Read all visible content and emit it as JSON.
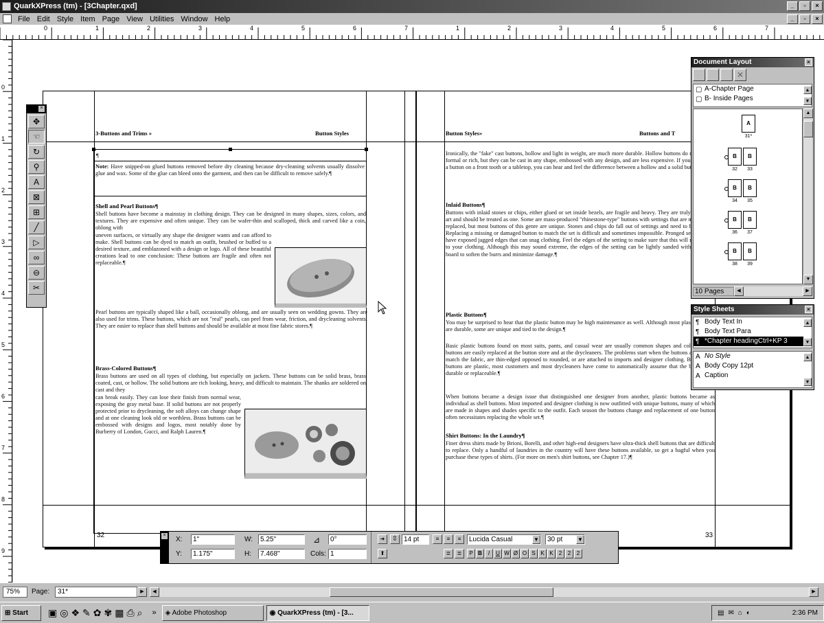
{
  "window": {
    "title": "QuarkXPress (tm) - [3Chapter.qxd]",
    "minimize": "_",
    "restore": "▫",
    "close": "×"
  },
  "menu": [
    "File",
    "Edit",
    "Style",
    "Item",
    "Page",
    "View",
    "Utilities",
    "Window",
    "Help"
  ],
  "ruler": {
    "top_labels": [
      "0",
      "1",
      "2",
      "3",
      "4",
      "5",
      "6",
      "7",
      "1",
      "2",
      "3",
      "4",
      "5",
      "6",
      "7"
    ],
    "side_labels": [
      "0",
      "1",
      "2",
      "3",
      "4",
      "5",
      "6",
      "7",
      "8",
      "9"
    ]
  },
  "left_page": {
    "running_left": "3-Buttons and Trims »",
    "running_right": "Button Styles",
    "pilcrow": "¶",
    "note_label": "Note:",
    "note_text": "Have snipped-on glued buttons removed before dry cleaning because dry-cleaning solvents usually dissolve glue and wax. Some of the glue can bleed onto the garment, and then can be difficult to remove safely.¶",
    "h1": "Shell and Pearl Buttons¶",
    "p1a": "Shell buttons have become a mainstay in clothing design. They can be designed in many shapes, sizes, colors, and textures. They are expensive and often unique. They can be wafer-thin and scalloped, thick and carved like a coin, oblong with",
    "p1b": "uneven surfaces, or virtually any shape the designer wants and can afford to make. Shell buttons can be dyed to match an outfit, brushed or buffed to a desired texture, and emblazoned with a design or logo. All of these beautiful creations lead to one conclusion: These buttons are fragile and often not replaceable.¶",
    "p2": "Pearl buttons are typically shaped like a ball, occasionally oblong, and are usually seen on wedding gowns. They are also used for trims. These buttons, which are not \"real\" pearls, can peel from wear, friction, and drycleaning solvents. They are easier to replace than shell buttons and should be available at most fine fabric stores.¶",
    "h2": "Brass-Colored Buttons¶",
    "p3a": "Brass buttons are used on all types of clothing, but especially on jackets. These buttons can be solid brass, brass coated, cast, or hollow. The solid buttons are rich looking, heavy, and difficult to maintain. The shanks are soldered on cast and they",
    "p3b": "can break easily. They can lose their finish from normal wear, exposing the gray metal base. If solid buttons are not properly protected prior to drycleaning, the soft alloys can change shape and at one cleaning look old or worthless. Brass buttons can be embossed with designs and logos, most notably done by Burberry of London, Gucci, and Ralph Lauren.¶",
    "folio": "32"
  },
  "right_page": {
    "running_left": "Button Styles»",
    "running_right": "Buttons and T",
    "p0": "Ironically, the \"fake\" cast buttons, hollow and light in weight, are much more durable. Hollow buttons do not look as formal or rich, but they can be cast in any shape, embossed with any design, and are less expensive. If you gently tap a button on a front tooth or a tabletop, you can hear and feel the difference between a hollow and a solid button.¶",
    "h1": "Inlaid Buttons¶",
    "p1": "Buttons with inlaid stones or chips, either glued or set inside bezels, are fragile and heavy. They are truly a work of art and should be treated as one. Some are mass-produced \"rhinestone-type\" buttons with settings that are more easily replaced, but most buttons of this genre are unique. Stones and chips do fall out of settings and need to be reglued. Replacing a missing or damaged button to match the set is difficult and sometimes impossible. Pronged settings may have exposed jagged edges that can snag clothing. Feel the edges of the setting to make sure that this will not happen to your clothing. Although this may sound extreme, the edges of the setting can be lightly sanded with an emery board to soften the burrs and minimize damage.¶",
    "h2": "Plastic Buttons¶",
    "p2": "You may be surprised to hear that the plastic button may be high maintenance as well. Although most plastic buttons are durable, some are unique and tied to the design.¶",
    "p3": "Basic plastic buttons found on most suits, pants, and casual wear are usually common shapes and colors. Black buttons are easily replaced at the button store and at the drycleaners. The problems start when the buttons are dyed to match the fabric, are thin-edged opposed to rounded, or are attached to imports and designer clothing. Because the buttons are plastic, most customers and most drycleaners have come to automatically assume that the buttons are durable or replaceable.¶",
    "p4": "When buttons became a design issue that distinguished one designer from another, plastic buttons became as individual as shell buttons. Most imported and designer clothing is now outfitted with unique buttons, many of which are made in shapes and shades specific to the outfit. Each season the buttons change and replacement of one button often necessitates replacing the whole set.¶",
    "h3": "Shirt Buttons: In the Laundry¶",
    "p5": "Finer dress shirts made by Brioni, Borelli, and other high-end designers have ultra-thick shell buttons that are difficult to replace. Only a handful of laundries in the country will have these buttons available, so get a bagful when you purchase these types of shirts. (For more on men's shirt buttons, see Chapter 17.)¶",
    "folio": "33"
  },
  "doc_layout": {
    "title": "Document Layout",
    "masters": [
      "A-Chapter Page",
      "B- Inside Pages"
    ],
    "first_page_label": "31*",
    "first_master": "A",
    "spreads": [
      {
        "left": "32",
        "right": "33",
        "master": "B"
      },
      {
        "left": "34",
        "right": "35",
        "master": "B"
      },
      {
        "left": "36",
        "right": "37",
        "master": "B"
      },
      {
        "left": "38",
        "right": "39",
        "master": "B"
      }
    ],
    "page_count": "10 Pages"
  },
  "style_sheets": {
    "title": "Style Sheets",
    "paragraph_styles": [
      "Body Text In",
      "Body Text Para",
      "*Chapter headingCtrl+KP 3"
    ],
    "selected_index": 2,
    "character_styles": [
      "No Style",
      "Body Copy 12pt",
      "Caption"
    ]
  },
  "measurements": {
    "x_label": "X:",
    "x_value": "1\"",
    "y_label": "Y:",
    "y_value": "1.175\"",
    "w_label": "W:",
    "w_value": "5.25\"",
    "h_label": "H:",
    "h_value": "7.468\"",
    "angle_value": "0°",
    "cols_label": "Cols:",
    "cols_value": "1",
    "leading_value": "14 pt",
    "font_value": "Lucida Casual",
    "size_value": "30 pt",
    "style_buttons": [
      "P",
      "B",
      "I",
      "U",
      "W",
      "Ø",
      "O",
      "S",
      "K",
      "K",
      "2",
      "2",
      "2"
    ]
  },
  "status": {
    "zoom": "75%",
    "page_label": "Page:",
    "page_value": "31*"
  },
  "taskbar": {
    "start": "Start",
    "overflow": "»",
    "task1": "Adobe Photoshop",
    "task2": "QuarkXPress (tm) - [3...",
    "clock": "2:36 PM"
  }
}
